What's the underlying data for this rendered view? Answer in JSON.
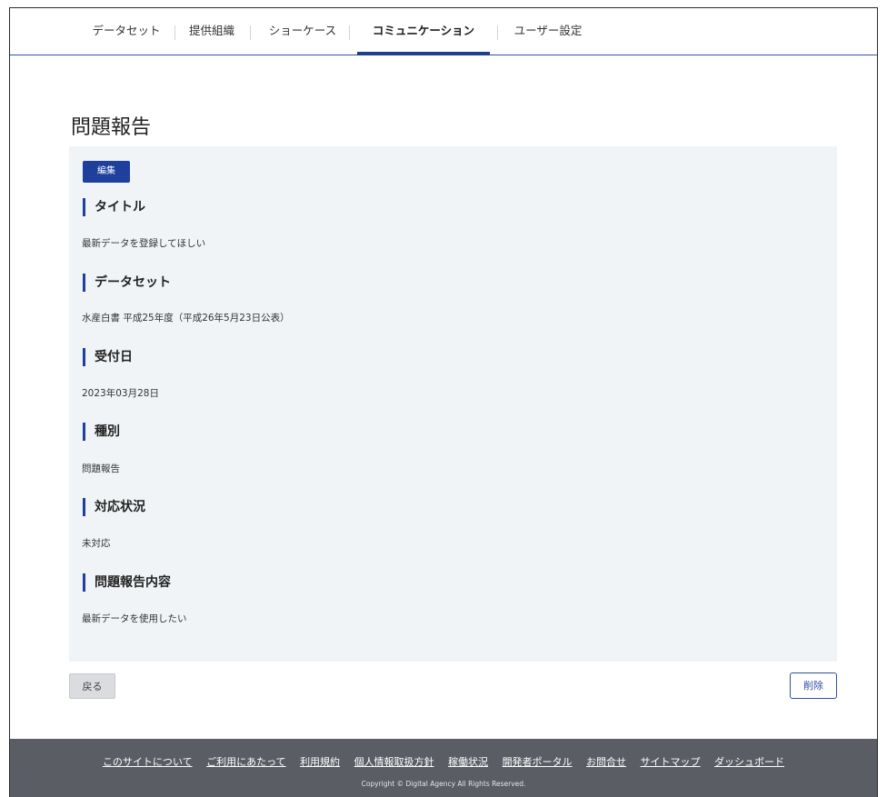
{
  "nav": {
    "tabs": [
      {
        "label": "データセット",
        "active": false
      },
      {
        "label": "提供組織",
        "active": false
      },
      {
        "label": "ショーケース",
        "active": false
      },
      {
        "label": "コミュニケーション",
        "active": true
      },
      {
        "label": "ユーザー設定",
        "active": false
      }
    ]
  },
  "page": {
    "title": "問題報告"
  },
  "detail": {
    "edit_label": "編集",
    "fields": [
      {
        "heading": "タイトル",
        "value": "最新データを登録してほしい"
      },
      {
        "heading": "データセット",
        "value": "水産白書 平成25年度（平成26年5月23日公表）"
      },
      {
        "heading": "受付日",
        "value": "2023年03月28日"
      },
      {
        "heading": "種別",
        "value": "問題報告"
      },
      {
        "heading": "対応状況",
        "value": "未対応"
      },
      {
        "heading": "問題報告内容",
        "value": "最新データを使用したい"
      }
    ]
  },
  "actions": {
    "back_label": "戻る",
    "delete_label": "削除"
  },
  "footer": {
    "links": [
      "このサイトについて",
      "ご利用にあたって",
      "利用規約",
      "個人情報取扱方針",
      "稼働状況",
      "開発者ポータル",
      "お問合せ",
      "サイトマップ",
      "ダッシュボード"
    ],
    "copyright": "Copyright © Digital Agency All Rights Reserved."
  },
  "colors": {
    "accent": "#1e3f9b",
    "panel": "#f1f4f7",
    "footer": "#5b5d65"
  }
}
